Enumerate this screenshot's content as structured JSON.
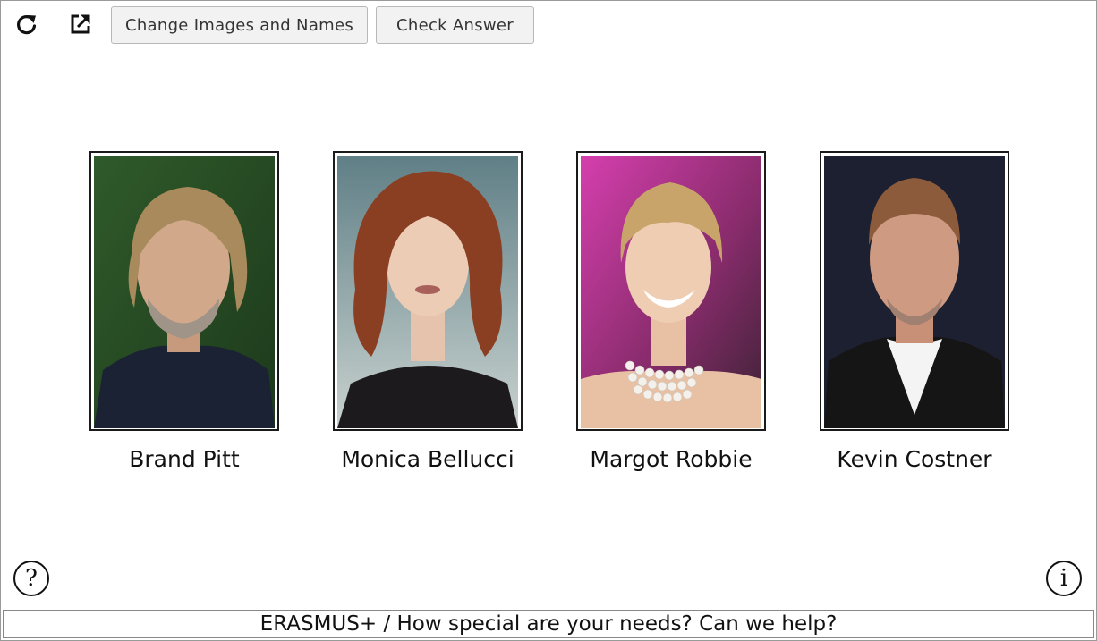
{
  "toolbar": {
    "reload_icon": "reload-icon",
    "external_link_icon": "external-link-icon",
    "change_button_label": "Change Images and Names",
    "check_button_label": "Check Answer"
  },
  "cards": [
    {
      "name": "Brand Pitt",
      "photo": "portrait-photo"
    },
    {
      "name": "Monica Bellucci",
      "photo": "portrait-photo"
    },
    {
      "name": "Margot Robbie",
      "photo": "portrait-photo"
    },
    {
      "name": "Kevin Costner",
      "photo": "portrait-photo"
    }
  ],
  "help_button": {
    "label": "?",
    "icon": "question-icon"
  },
  "info_button": {
    "label": "i",
    "icon": "info-icon"
  },
  "footer": {
    "text": "ERASMUS+ / How special are your needs? Can we help?"
  },
  "colors": {
    "border": "#1a1a1a",
    "button_bg": "#f2f2f2",
    "button_border": "#b8b8b8"
  }
}
